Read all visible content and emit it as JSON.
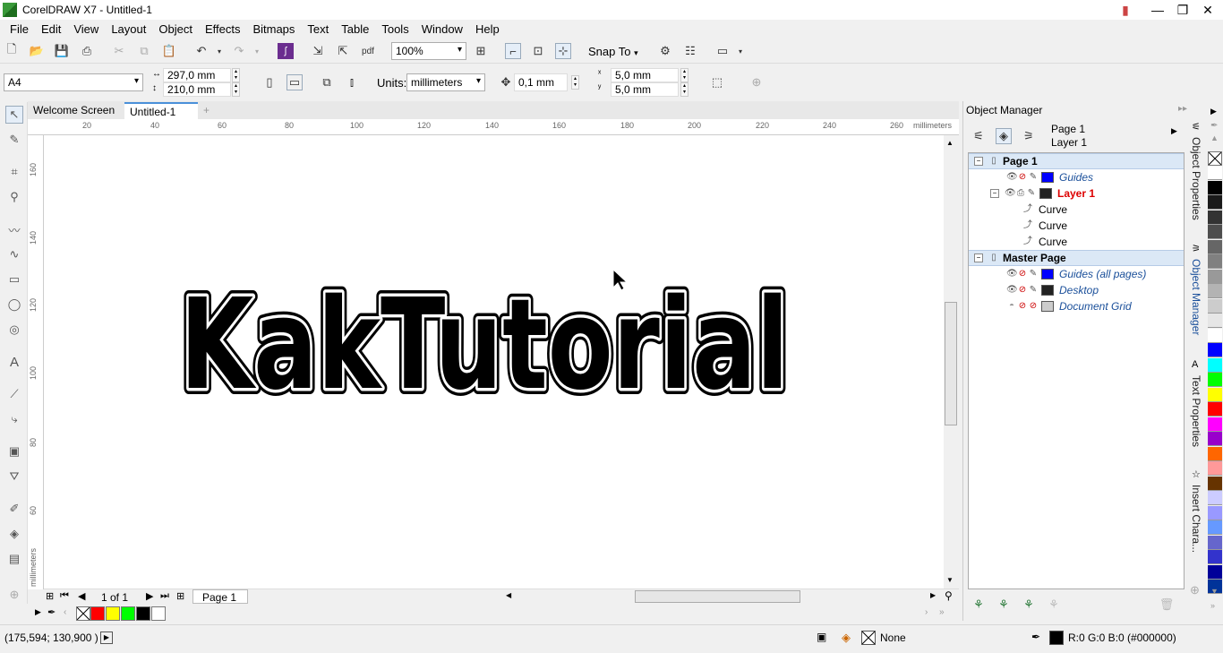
{
  "window": {
    "title": "CorelDRAW X7 - Untitled-1"
  },
  "menu": [
    "File",
    "Edit",
    "View",
    "Layout",
    "Object",
    "Effects",
    "Bitmaps",
    "Text",
    "Table",
    "Tools",
    "Window",
    "Help"
  ],
  "toolbar": {
    "zoom": "100%",
    "snap_to": "Snap To"
  },
  "property_bar": {
    "page_size": "A4",
    "width": "297,0 mm",
    "height": "210,0 mm",
    "units_label": "Units:",
    "units_value": "millimeters",
    "nudge": "0,1 mm",
    "dup_x": "5,0 mm",
    "dup_y": "5,0 mm"
  },
  "doc_tabs": [
    "Welcome Screen",
    "Untitled-1"
  ],
  "rulers": {
    "top_ticks": [
      "20",
      "40",
      "60",
      "80",
      "100",
      "120",
      "140",
      "160",
      "180",
      "200",
      "220",
      "240",
      "260"
    ],
    "top_unit": "millimeters",
    "left_ticks": [
      "160",
      "140",
      "120",
      "100",
      "80",
      "60"
    ],
    "left_unit": "millimeters"
  },
  "canvas": {
    "artwork_text": "KakTutorial"
  },
  "page_nav": {
    "counter": "1 of 1",
    "page_tab": "Page 1"
  },
  "doc_palette": [
    "#ff0000",
    "#ffff00",
    "#00ff00",
    "#000000",
    "#ffffff"
  ],
  "status": {
    "coords": "(175,594; 130,900 )",
    "fill_label": "None",
    "outline_label": "R:0 G:0 B:0 (#000000)"
  },
  "object_manager": {
    "title": "Object Manager",
    "header_page": "Page 1",
    "header_layer": "Layer 1",
    "rows": [
      {
        "label": "Page 1",
        "kind": "page"
      },
      {
        "label": "Guides",
        "kind": "layer",
        "color": "#0000ff"
      },
      {
        "label": "Layer 1",
        "kind": "active-layer",
        "color": "#222222"
      },
      {
        "label": "Curve",
        "kind": "object"
      },
      {
        "label": "Curve",
        "kind": "object"
      },
      {
        "label": "Curve",
        "kind": "object"
      },
      {
        "label": "Master Page",
        "kind": "page"
      },
      {
        "label": "Guides (all pages)",
        "kind": "layer",
        "color": "#0000ff"
      },
      {
        "label": "Desktop",
        "kind": "layer",
        "color": "#222222"
      },
      {
        "label": "Document Grid",
        "kind": "layer",
        "color": "#cccccc"
      }
    ]
  },
  "docker_tabs": [
    "Object Properties",
    "Object Manager",
    "Text Properties",
    "Insert Chara..."
  ],
  "color_palette": [
    "#ffffff",
    "#000000",
    "#1a1a1a",
    "#333333",
    "#4d4d4d",
    "#666666",
    "#808080",
    "#999999",
    "#b3b3b3",
    "#cccccc",
    "#e6e6e6",
    "#ffffff",
    "#0000ff",
    "#00ffff",
    "#00ff00",
    "#ffff00",
    "#ff0000",
    "#ff00ff",
    "#9900cc",
    "#ff6600",
    "#ff9999",
    "#663300",
    "#ccccff",
    "#9999ff",
    "#6699ff",
    "#6666cc",
    "#3333cc",
    "#000099",
    "#003399"
  ]
}
